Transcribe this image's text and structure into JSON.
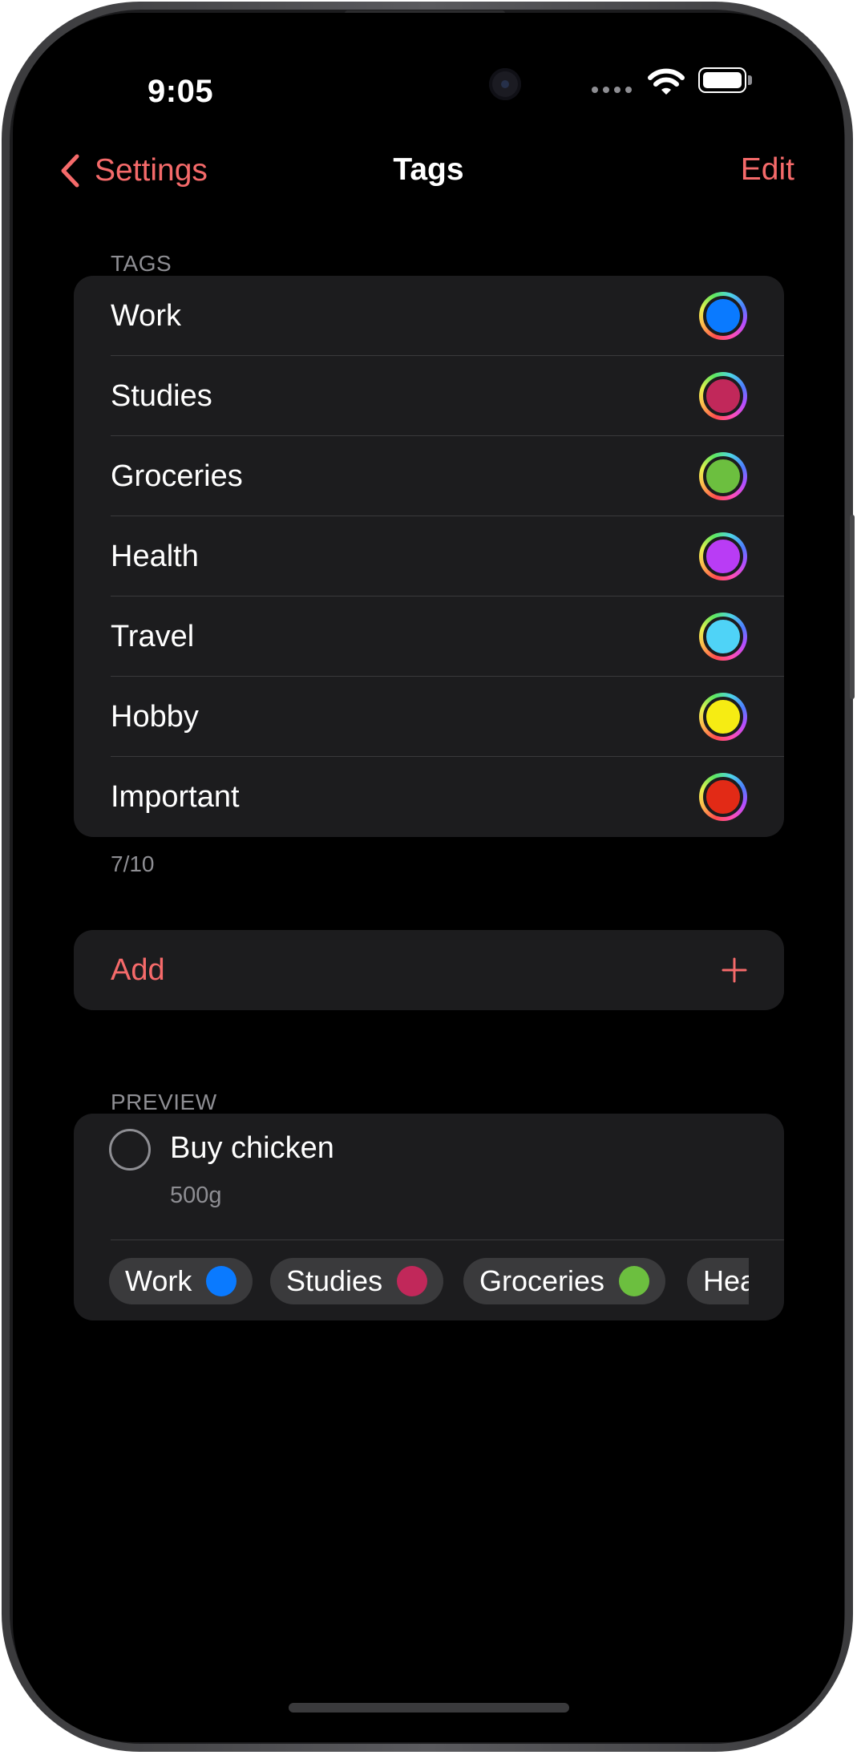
{
  "status_bar": {
    "time": "9:05"
  },
  "nav": {
    "back_label": "Settings",
    "title": "Tags",
    "edit_label": "Edit"
  },
  "tags_section": {
    "header": "TAGS",
    "items": [
      {
        "label": "Work",
        "color": "#0a7aff"
      },
      {
        "label": "Studies",
        "color": "#c1285a"
      },
      {
        "label": "Groceries",
        "color": "#6cbf3f"
      },
      {
        "label": "Health",
        "color": "#b93cf5"
      },
      {
        "label": "Travel",
        "color": "#4fd3f7"
      },
      {
        "label": "Hobby",
        "color": "#f6ec13"
      },
      {
        "label": "Important",
        "color": "#e22a16"
      }
    ],
    "footer": "7/10"
  },
  "add": {
    "label": "Add",
    "icon": "plus-icon"
  },
  "preview": {
    "header": "PREVIEW",
    "task_title": "Buy chicken",
    "task_subtitle": "500g",
    "chips": [
      {
        "label": "Work",
        "color": "#0a7aff"
      },
      {
        "label": "Studies",
        "color": "#c1285a"
      },
      {
        "label": "Groceries",
        "color": "#6cbf3f"
      },
      {
        "label": "Health",
        "color": "#b93cf5"
      }
    ]
  },
  "theme": {
    "accent": "#f56a6a",
    "background": "#000000",
    "card": "#1c1c1e"
  }
}
